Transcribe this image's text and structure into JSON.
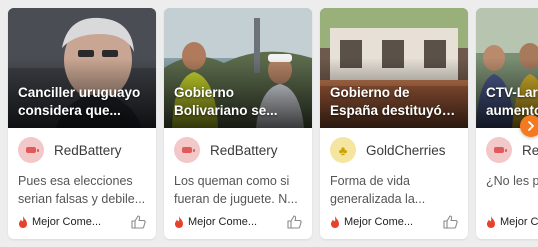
{
  "colors": {
    "accent": "#f57a1f",
    "flame": "#e8412c",
    "red_source_bg": "#f3c8c8",
    "gold_source_bg": "#f5e5a0"
  },
  "cards": [
    {
      "headline": "Canciller uruguayo considera que...",
      "source_name": "RedBattery",
      "source_icon": "battery-icon",
      "excerpt": "Pues esa elecciones serian falsas y debile...",
      "tag_label": "Mejor Come...",
      "tag_icon": "flame-icon",
      "like_icon": "thumbs-up-icon"
    },
    {
      "headline": "Gobierno Bolivariano se...",
      "source_name": "RedBattery",
      "source_icon": "battery-icon",
      "excerpt": "Los queman como si fueran de juguete. N...",
      "tag_label": "Mejor Come...",
      "tag_icon": "flame-icon",
      "like_icon": "thumbs-up-icon"
    },
    {
      "headline": "Gobierno de España destituyó al...",
      "source_name": "GoldCherries",
      "source_icon": "cherries-icon",
      "excerpt": "Forma de vida generalizada la...",
      "tag_label": "Mejor Come...",
      "tag_icon": "flame-icon",
      "like_icon": "thumbs-up-icon"
    },
    {
      "headline": "CTV-Lara aumento...",
      "source_name": "RedBattery",
      "source_icon": "battery-icon",
      "excerpt": "¿No les p perversos...",
      "tag_label": "Mejor Come...",
      "tag_icon": "flame-icon",
      "like_icon": "thumbs-up-icon"
    }
  ],
  "next_button_icon": "chevron-right-icon"
}
